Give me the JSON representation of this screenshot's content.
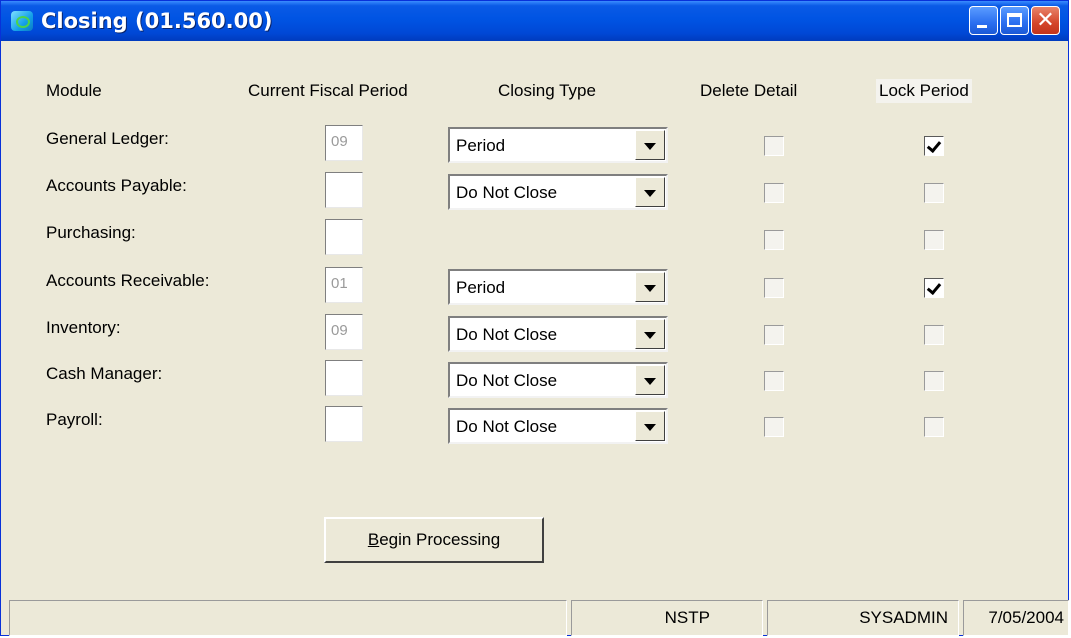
{
  "window": {
    "title": "Closing (01.560.00)",
    "buttons": {
      "minimize": "minimize",
      "maximize": "maximize",
      "close": "✕"
    }
  },
  "headers": {
    "module": "Module",
    "period": "Current Fiscal Period",
    "type": "Closing Type",
    "delete": "Delete Detail",
    "lock": "Lock Period"
  },
  "rows": [
    {
      "module": "General Ledger:",
      "period": "09",
      "closing_type": "Period",
      "delete_detail": false,
      "lock_period": true
    },
    {
      "module": "Accounts Payable:",
      "period": "",
      "closing_type": "Do Not Close",
      "delete_detail": false,
      "lock_period": false
    },
    {
      "module": "Purchasing:",
      "period": "",
      "closing_type": null,
      "delete_detail": false,
      "lock_period": false
    },
    {
      "module": "Accounts Receivable:",
      "period": "01",
      "closing_type": "Period",
      "delete_detail": false,
      "lock_period": true
    },
    {
      "module": "Inventory:",
      "period": "09",
      "closing_type": "Do Not Close",
      "delete_detail": false,
      "lock_period": false
    },
    {
      "module": "Cash Manager:",
      "period": "",
      "closing_type": "Do Not Close",
      "delete_detail": false,
      "lock_period": false
    },
    {
      "module": "Payroll:",
      "period": "",
      "closing_type": "Do Not Close",
      "delete_detail": false,
      "lock_period": false
    }
  ],
  "action": {
    "accel": "B",
    "rest": "egin Processing"
  },
  "status": {
    "pane1": "",
    "pane2": "NSTP",
    "pane3": "SYSADMIN",
    "pane4": "7/05/2004"
  }
}
